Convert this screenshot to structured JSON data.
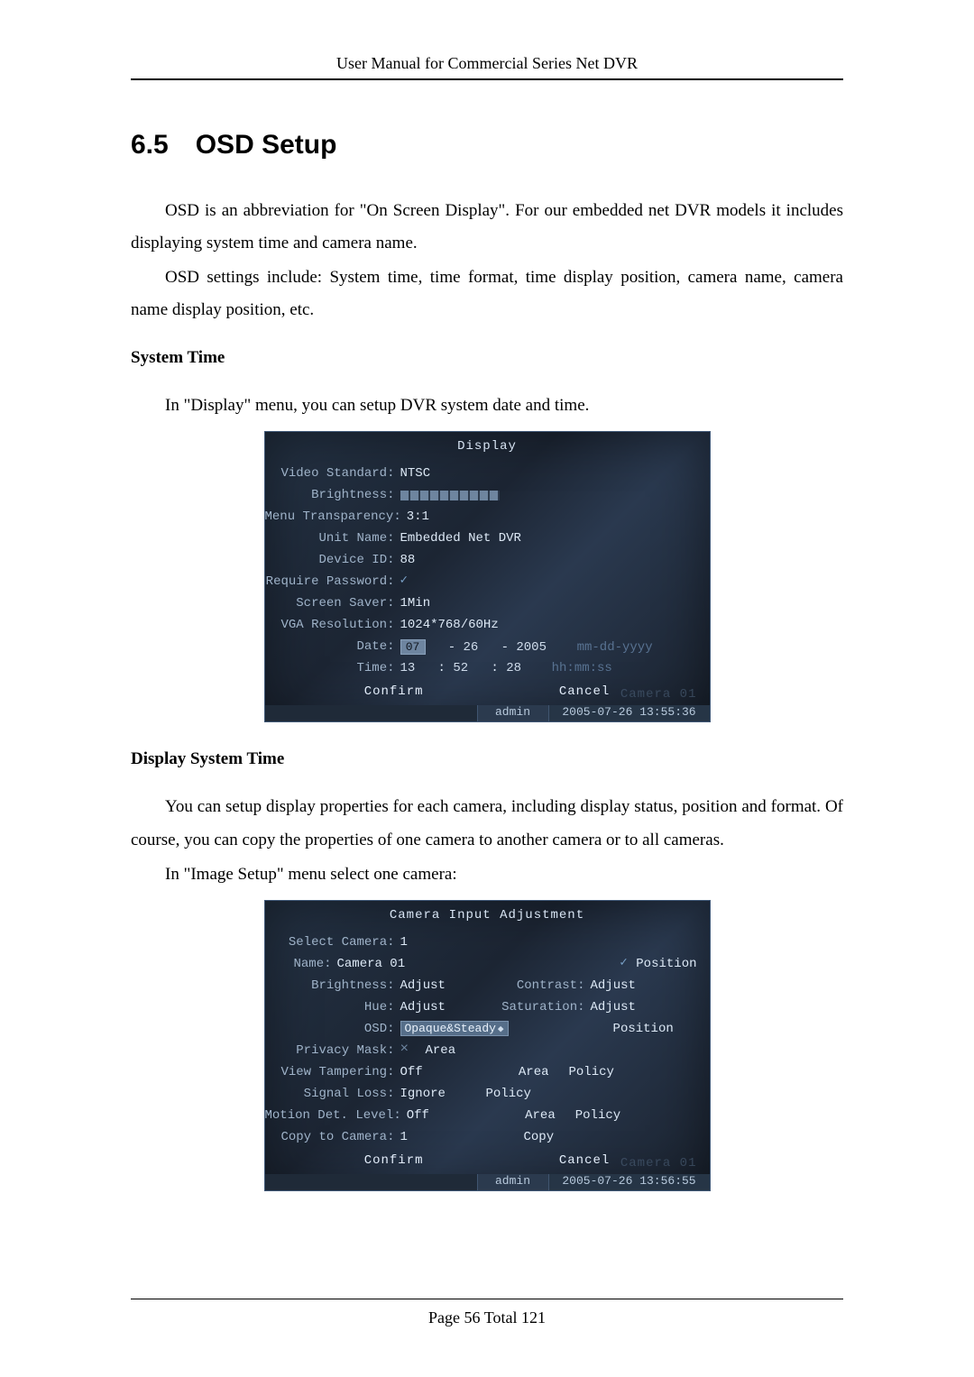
{
  "header": "User Manual for Commercial Series Net DVR",
  "section": {
    "number": "6.5",
    "title": "OSD Setup"
  },
  "para": {
    "p1": "OSD is an abbreviation for \"On Screen Display\". For our embedded net DVR models it includes displaying system time and camera name.",
    "p2": "OSD settings include: System time, time format, time display position, camera name, camera name display position, etc.",
    "h1": "System Time",
    "p3": "In \"Display\" menu, you can setup DVR system date and time.",
    "h2": "Display System Time",
    "p4": "You can setup display properties for each camera, including display status, position and format. Of course, you can copy the properties of one camera to another camera or to all cameras.",
    "p5": "In \"Image Setup\" menu select one camera:"
  },
  "display_menu": {
    "title": "Display",
    "watermark": "Camera 01",
    "labels": {
      "video_standard": "Video Standard:",
      "brightness": "Brightness:",
      "menu_transparency": "Menu Transparency:",
      "unit_name": "Unit Name:",
      "device_id": "Device ID:",
      "require_password": "Require Password:",
      "screen_saver": "Screen Saver:",
      "vga_resolution": "VGA Resolution:",
      "date": "Date:",
      "time": "Time:"
    },
    "values": {
      "video_standard": "NTSC",
      "menu_transparency": "3:1",
      "unit_name": "Embedded Net DVR",
      "device_id": "88",
      "screen_saver": "1Min",
      "vga_resolution": "1024*768/60Hz"
    },
    "date": {
      "m": "07",
      "d": "26",
      "y": "2005",
      "fmt": "mm-dd-yyyy",
      "sep": "-"
    },
    "time": {
      "h": "13",
      "m": "52",
      "s": "28",
      "fmt": "hh:mm:ss",
      "sep": ":"
    },
    "confirm": "Confirm",
    "cancel": "Cancel",
    "status_user": "admin",
    "status_ts": "2005-07-26 13:55:36"
  },
  "camera_menu": {
    "title": "Camera Input Adjustment",
    "watermark": "Camera 01",
    "labels": {
      "select_camera": "Select Camera:",
      "name": "Name:",
      "brightness": "Brightness:",
      "contrast": "Contrast:",
      "hue": "Hue:",
      "saturation": "Saturation:",
      "osd": "OSD:",
      "privacy_mask": "Privacy Mask:",
      "view_tampering": "View Tampering:",
      "signal_loss": "Signal Loss:",
      "motion": "Motion Det. Level:",
      "copy_to": "Copy to Camera:",
      "copy": "Copy"
    },
    "values": {
      "select_camera": "1",
      "name": "Camera 01",
      "adjust": "Adjust",
      "osd_mode": "Opaque&Steady",
      "position": "Position",
      "area": "Area",
      "off": "Off",
      "ignore": "Ignore",
      "policy": "Policy",
      "copy_to_val": "1"
    },
    "confirm": "Confirm",
    "cancel": "Cancel",
    "status_user": "admin",
    "status_ts": "2005-07-26 13:56:55"
  },
  "footer": {
    "page_label": "Page",
    "page_num": "56",
    "total_label": "Total",
    "total_num": "121"
  }
}
